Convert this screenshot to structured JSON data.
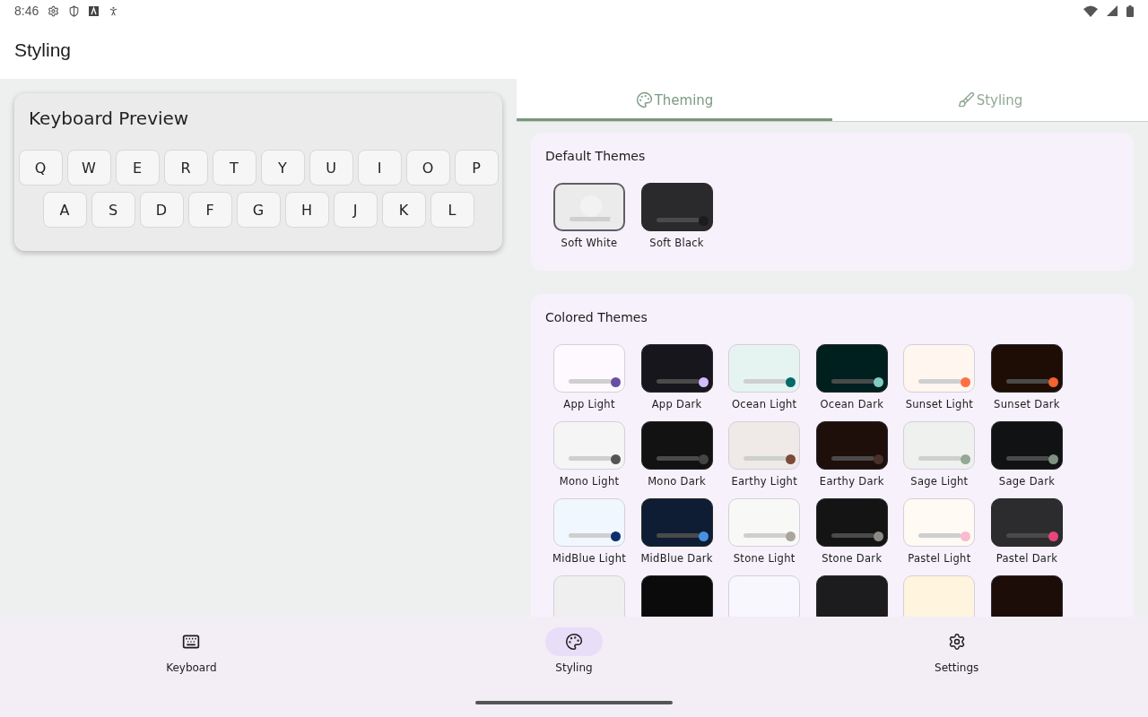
{
  "status_bar": {
    "time": "8:46"
  },
  "app_bar": {
    "title": "Styling"
  },
  "preview": {
    "title": "Keyboard Preview",
    "rows": [
      [
        "Q",
        "W",
        "E",
        "R",
        "T",
        "Y",
        "U",
        "I",
        "O",
        "P"
      ],
      [
        "A",
        "S",
        "D",
        "F",
        "G",
        "H",
        "J",
        "K",
        "L"
      ]
    ]
  },
  "tabs": [
    {
      "label": "Theming",
      "selected": true
    },
    {
      "label": "Styling",
      "selected": false
    }
  ],
  "sections": [
    {
      "title": "Default Themes",
      "themes": [
        {
          "name": "Soft White",
          "kind": "light",
          "selected": true,
          "swatch": {
            "color": "#ebebeb"
          },
          "dot": {
            "color": "#ebebeb"
          }
        },
        {
          "name": "Soft Black",
          "kind": "dark",
          "selected": false,
          "swatch": {
            "color": "#2a2a2c"
          },
          "dot": {
            "color": "#1c1c1e"
          }
        }
      ]
    },
    {
      "title": "Colored Themes",
      "themes": [
        {
          "name": "App Light",
          "kind": "light",
          "selected": false,
          "swatch": {
            "color": "#fdf9ff"
          },
          "dot": {
            "color": "#6750a4"
          }
        },
        {
          "name": "App Dark",
          "kind": "dark",
          "selected": false,
          "swatch": {
            "color": "#17161c"
          },
          "dot": {
            "color": "#d0bcff"
          }
        },
        {
          "name": "Ocean Light",
          "kind": "light",
          "selected": false,
          "swatch": {
            "color": "#e5f4f1"
          },
          "dot": {
            "color": "#006a6a"
          }
        },
        {
          "name": "Ocean Dark",
          "kind": "dark",
          "selected": false,
          "swatch": {
            "color": "#001f1f"
          },
          "dot": {
            "color": "#80cbc4"
          }
        },
        {
          "name": "Sunset Light",
          "kind": "light",
          "selected": false,
          "swatch": {
            "color": "#fff6f0"
          },
          "dot": {
            "color": "#ff7043"
          }
        },
        {
          "name": "Sunset Dark",
          "kind": "dark",
          "selected": false,
          "swatch": {
            "color": "#1e0d05"
          },
          "dot": {
            "color": "#f4622e"
          }
        },
        {
          "name": "Mono Light",
          "kind": "light",
          "selected": false,
          "swatch": {
            "color": "#f4f5f4"
          },
          "dot": {
            "color": "#555555"
          }
        },
        {
          "name": "Mono Dark",
          "kind": "dark",
          "selected": false,
          "swatch": {
            "color": "#121212"
          },
          "dot": {
            "color": "#444444"
          }
        },
        {
          "name": "Earthy Light",
          "kind": "light",
          "selected": false,
          "swatch": {
            "color": "#efe9e7"
          },
          "dot": {
            "color": "#7b4a3a"
          }
        },
        {
          "name": "Earthy Dark",
          "kind": "dark",
          "selected": false,
          "swatch": {
            "color": "#1e0f0b"
          },
          "dot": {
            "color": "#4a3029"
          }
        },
        {
          "name": "Sage Light",
          "kind": "light",
          "selected": false,
          "swatch": {
            "color": "#eef1ee"
          },
          "dot": {
            "color": "#93a895"
          }
        },
        {
          "name": "Sage Dark",
          "kind": "dark",
          "selected": false,
          "swatch": {
            "color": "#111213"
          },
          "dot": {
            "color": "#7d9280"
          }
        },
        {
          "name": "MidBlue Light",
          "kind": "light",
          "selected": false,
          "swatch": {
            "color": "#f0f7fe"
          },
          "dot": {
            "color": "#0d2f6b"
          }
        },
        {
          "name": "MidBlue Dark",
          "kind": "dark",
          "selected": false,
          "swatch": {
            "color": "#0e1d33"
          },
          "dot": {
            "color": "#4a90e2"
          }
        },
        {
          "name": "Stone Light",
          "kind": "light",
          "selected": false,
          "swatch": {
            "color": "#f8f8f7"
          },
          "dot": {
            "color": "#aaa69c"
          }
        },
        {
          "name": "Stone Dark",
          "kind": "dark",
          "selected": false,
          "swatch": {
            "color": "#141414"
          },
          "dot": {
            "color": "#8d8a85"
          }
        },
        {
          "name": "Pastel Light",
          "kind": "light",
          "selected": false,
          "swatch": {
            "color": "#fffaf3"
          },
          "dot": {
            "color": "#f8bbd0"
          }
        },
        {
          "name": "Pastel Dark",
          "kind": "dark",
          "selected": false,
          "swatch": {
            "color": "#2c2c2e"
          },
          "dot": {
            "color": "#e8457b"
          }
        },
        {
          "kind": "light",
          "selected": false,
          "swatch": {
            "color": "#efefef"
          }
        },
        {
          "kind": "dark",
          "selected": false,
          "swatch": {
            "color": "#0b0b0b"
          }
        },
        {
          "kind": "light",
          "selected": false,
          "swatch": {
            "color": "#f8f7fd"
          }
        },
        {
          "kind": "dark",
          "selected": false,
          "swatch": {
            "color": "#1c1c1e"
          }
        },
        {
          "kind": "light",
          "selected": false,
          "swatch": {
            "color": "#fff4dd"
          }
        },
        {
          "kind": "dark",
          "selected": false,
          "swatch": {
            "color": "#1d0d08"
          }
        }
      ]
    }
  ],
  "nav": [
    {
      "label": "Keyboard",
      "selected": false
    },
    {
      "label": "Styling",
      "selected": true
    },
    {
      "label": "Settings",
      "selected": false
    }
  ]
}
